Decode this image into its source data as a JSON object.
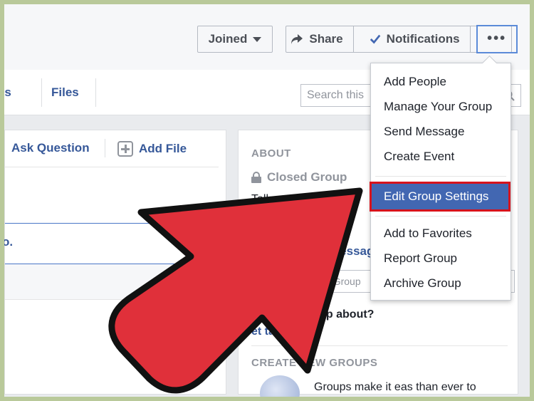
{
  "header": {
    "joined_label": "Joined",
    "share_label": "Share",
    "notifications_label": "Notifications",
    "more_label": "•••"
  },
  "tabs": {
    "photos_label": "os",
    "files_label": "Files",
    "search_placeholder": "Search this"
  },
  "composer": {
    "ask_question_label": "Ask Question",
    "add_file_label": "Add File",
    "post_partial": "o."
  },
  "about": {
    "heading": "ABOUT",
    "privacy": "Closed Group",
    "description_partial": "Tell people what this",
    "message_link_partial": "Messag",
    "add_people_placeholder_partial": "eople to Group",
    "question_partial": "at is this group about?",
    "tags_partial": "et tags",
    "create_heading": "CREATE NEW GROUPS",
    "groups_text_partial": "Groups make it eas     than ever to"
  },
  "menu": {
    "items": [
      "Add People",
      "Manage Your Group",
      "Send Message",
      "Create Event",
      "Edit Group Settings",
      "Add to Favorites",
      "Report Group",
      "Archive Group"
    ],
    "highlighted_index": 4
  },
  "colors": {
    "accent": "#4267b2",
    "highlight_border": "#d7131c",
    "arrow_fill": "#e0303a",
    "link": "#365899"
  }
}
